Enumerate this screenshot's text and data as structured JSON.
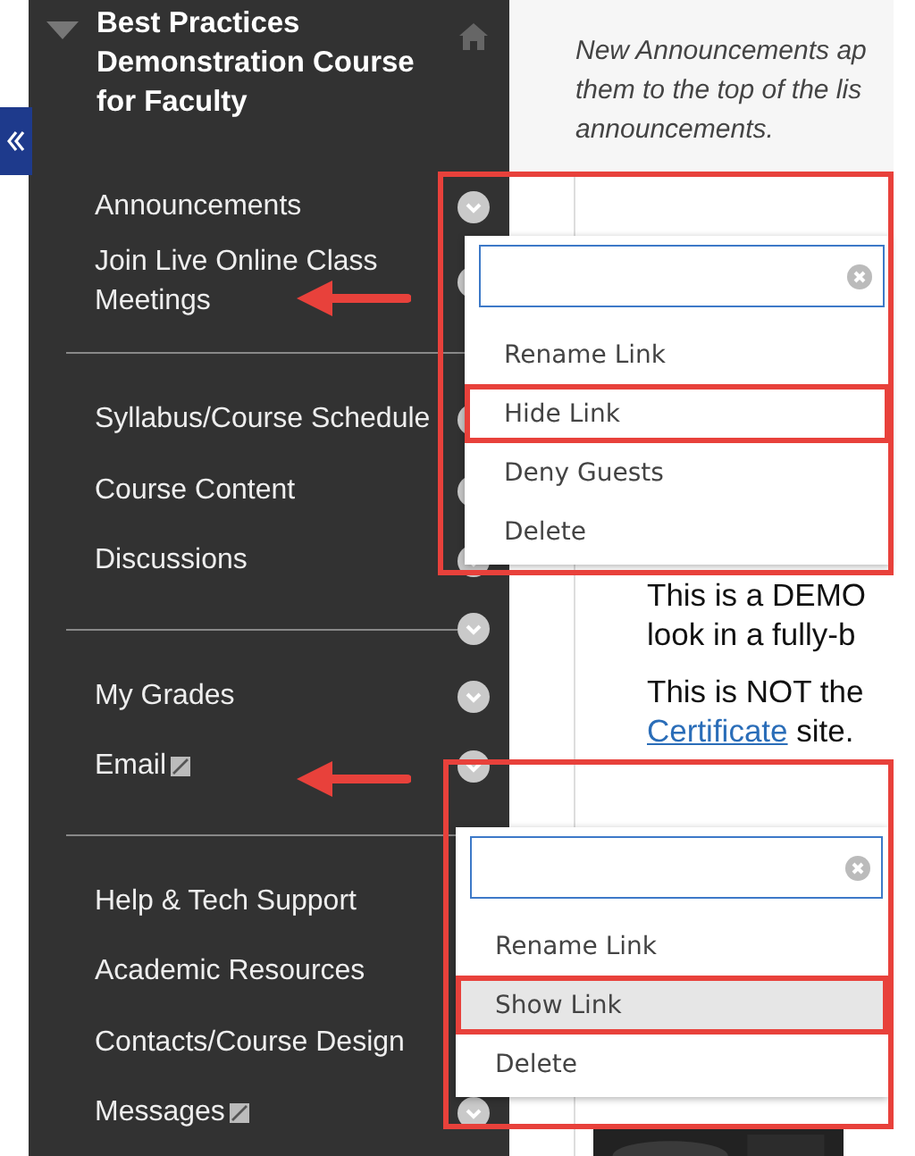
{
  "course_title": "Best Practices Demonstration Course for Faculty",
  "nav_groups": [
    {
      "items": [
        {
          "label": "Announcements",
          "toggle": true,
          "hidden": false,
          "arrow": false
        },
        {
          "label": "Join Live Online Class Meetings",
          "toggle": true,
          "hidden": false,
          "arrow": true
        }
      ]
    },
    {
      "items": [
        {
          "label": "Syllabus/Course Schedule",
          "toggle": true,
          "hidden": false,
          "arrow": false
        },
        {
          "label": "Course Content",
          "toggle": true,
          "hidden": false,
          "arrow": false
        },
        {
          "label": "Discussions",
          "toggle": true,
          "hidden": false,
          "arrow": false
        }
      ]
    },
    {
      "divider_toggle": true,
      "items": [
        {
          "label": "My Grades",
          "toggle": true,
          "hidden": false,
          "arrow": false
        },
        {
          "label": "Email",
          "toggle": true,
          "hidden": true,
          "arrow": true
        }
      ]
    },
    {
      "items": [
        {
          "label": "Help & Tech Support",
          "toggle": false,
          "hidden": false,
          "arrow": false
        },
        {
          "label": "Academic Resources",
          "toggle": false,
          "hidden": false,
          "arrow": false
        },
        {
          "label": "Contacts/Course Design",
          "toggle": false,
          "hidden": false,
          "arrow": false
        },
        {
          "label": "Messages",
          "toggle": true,
          "hidden": true,
          "arrow": false
        }
      ]
    }
  ],
  "content": {
    "note_lines": [
      "New Announcements ap",
      "them to the top of the lis",
      "announcements."
    ],
    "body_lines": [
      "This is a DEMO",
      "look in a fully-b"
    ],
    "link": "Certificate",
    "after_link": " site.",
    "line_before_link": "This is NOT the"
  },
  "menus": [
    {
      "outlined": true,
      "items": [
        {
          "label": "Rename Link",
          "selected": false,
          "outlined": false
        },
        {
          "label": "Hide Link",
          "selected": false,
          "outlined": true
        },
        {
          "label": "Deny Guests",
          "selected": false,
          "outlined": false
        },
        {
          "label": "Delete",
          "selected": false,
          "outlined": false
        }
      ]
    },
    {
      "outlined": true,
      "items": [
        {
          "label": "Rename Link",
          "selected": false,
          "outlined": false
        },
        {
          "label": "Show Link",
          "selected": true,
          "outlined": true
        },
        {
          "label": "Delete",
          "selected": false,
          "outlined": false
        }
      ]
    }
  ]
}
